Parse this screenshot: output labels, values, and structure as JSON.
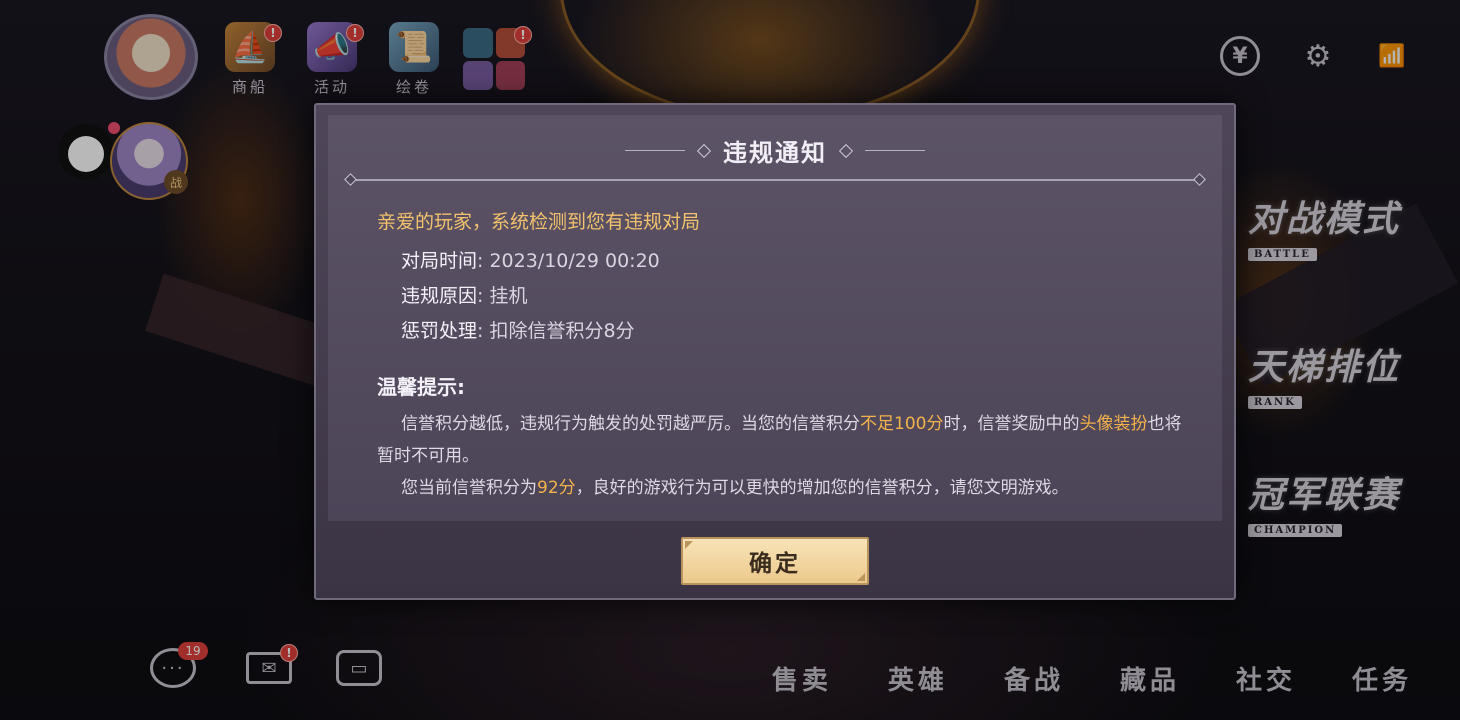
{
  "top_nav": {
    "items": [
      {
        "label": "商船",
        "icon": "ship-icon",
        "has_alert": true
      },
      {
        "label": "活动",
        "icon": "horn-icon",
        "has_alert": true
      },
      {
        "label": "绘卷",
        "icon": "scroll-icon",
        "has_alert": false
      },
      {
        "label": "",
        "icon": "feature-grid-icon",
        "has_alert": true
      }
    ],
    "alert_mark": "!"
  },
  "side_avatar": {
    "tag": "战"
  },
  "top_right": {
    "coin_icon": "¥",
    "settings_icon": "gear-icon",
    "network_icon": "wifi-battery-icon"
  },
  "modes": [
    {
      "title": "对战模式",
      "sub": "BATTLE"
    },
    {
      "title": "天梯排位",
      "sub": "RANK"
    },
    {
      "title": "冠军联赛",
      "sub": "CHAMPION"
    }
  ],
  "bottom": {
    "chat_badge": "19",
    "mail_alert": "!",
    "nav": [
      "售卖",
      "英雄",
      "备战",
      "藏品",
      "社交",
      "任务"
    ]
  },
  "dialog": {
    "title": "违规通知",
    "greeting": "亲爱的玩家，系统检测到您有违规对局",
    "rows": [
      {
        "key": "对局时间",
        "value": ": 2023/10/29 00:20"
      },
      {
        "key": "违规原因",
        "value": ": 挂机"
      },
      {
        "key": "惩罚处理",
        "value": ": 扣除信誉积分8分"
      }
    ],
    "tip_title": "温馨提示:",
    "tip1_a": "信誉积分越低，违规行为触发的处罚越严厉。当您的信誉积分",
    "tip1_hl1": "不足100分",
    "tip1_b": "时，信誉奖励中的",
    "tip1_hl2": "头像装扮",
    "tip1_c": "也将暂时不可用。",
    "tip2_a": "您当前信誉积分为",
    "tip2_hl": "92分",
    "tip2_b": "，良好的游戏行为可以更快的增加您的信誉积分，请您文明游戏。",
    "confirm_label": "确定"
  }
}
